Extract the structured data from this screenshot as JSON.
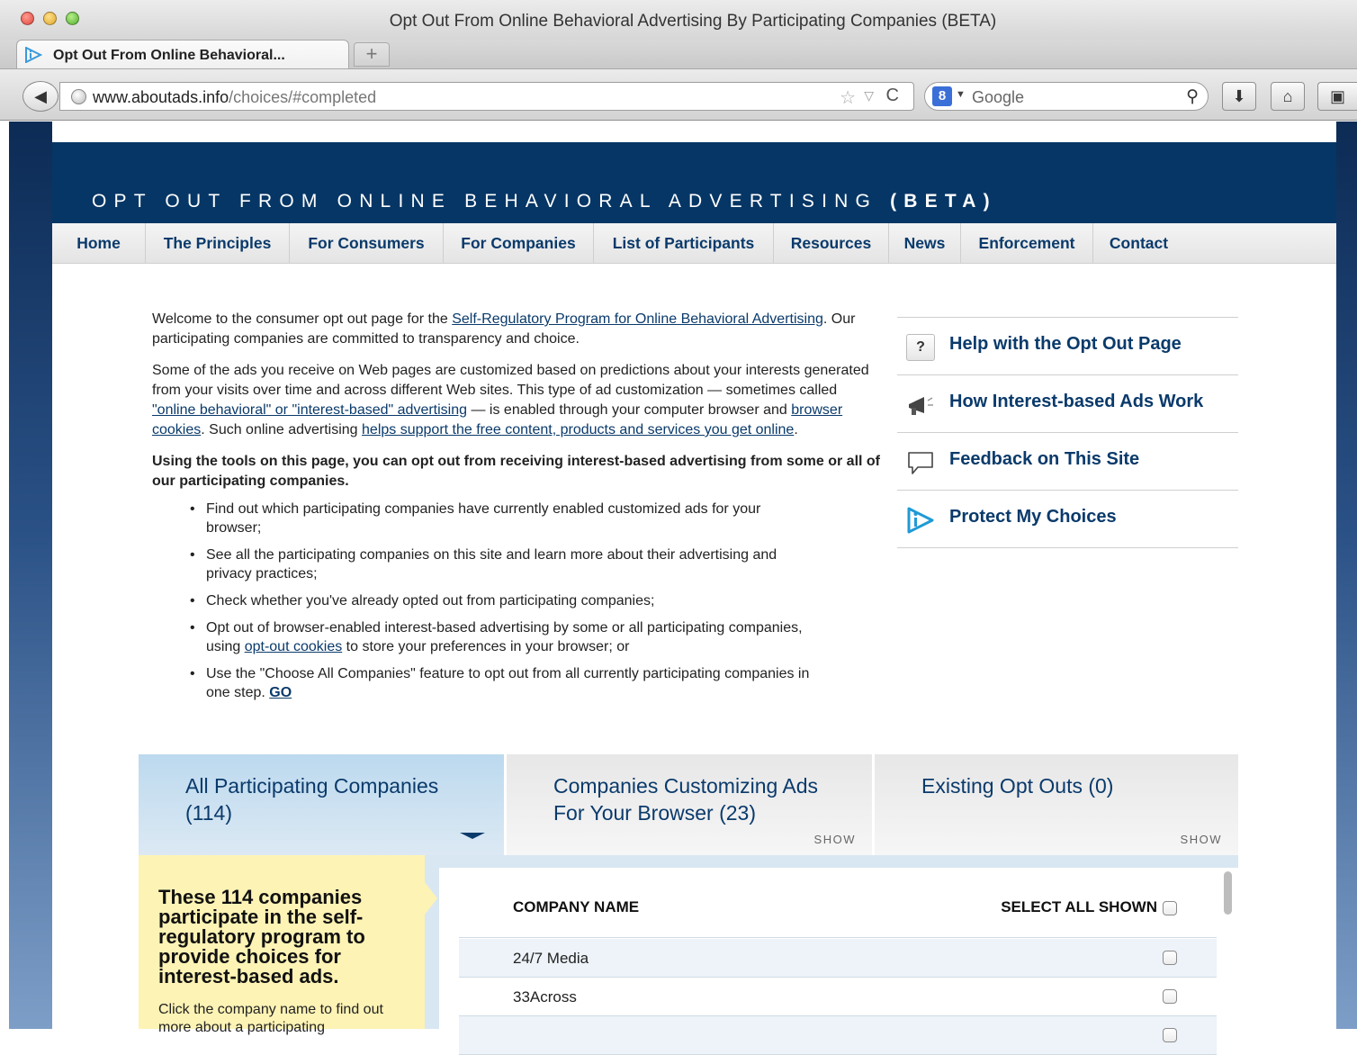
{
  "browser": {
    "window_title": "Opt Out From Online Behavioral Advertising By Participating Companies (BETA)",
    "tab_label": "Opt Out From Online Behavioral...",
    "new_tab_label": "+",
    "url_host": "www.aboutads.info",
    "url_path": "/choices/#completed",
    "search_engine_letter": "8",
    "search_placeholder": "Google",
    "icons": {
      "back": "back-arrow-icon",
      "globe": "globe-icon",
      "star": "bookmark-star-icon",
      "reload": "reload-icon",
      "search": "magnifier-icon",
      "download": "download-icon",
      "home": "home-icon",
      "bookmarks": "bookmarks-icon"
    },
    "glyphs": {
      "back": "◀",
      "star": "☆",
      "dropdown": "▽",
      "reload": "C",
      "caret": "▼",
      "search": "⚲",
      "download": "⬇",
      "home": "⌂",
      "bookmarks": "▣"
    }
  },
  "site": {
    "banner_title_main": "OPT OUT FROM ONLINE BEHAVIORAL ADVERTISING",
    "banner_title_suffix": "(BETA)",
    "nav": [
      "Home",
      "The Principles",
      "For Consumers",
      "For Companies",
      "List of Participants",
      "Resources",
      "News",
      "Enforcement",
      "Contact"
    ],
    "colors": {
      "banner": "#063665",
      "link": "#0a3a6b",
      "info_box": "#fdf3b5",
      "tab_active": "#bcd9ee"
    }
  },
  "intro": {
    "p1_before": "Welcome to the consumer opt out page for the ",
    "p1_link": "Self-Regulatory Program for Online Behavioral Advertising",
    "p1_after": ". Our participating companies are committed to transparency and choice.",
    "p2_a": "Some of the ads you receive on Web pages are customized based on predictions about your interests generated from your visits over time and across different Web sites. This type of ad customization — sometimes called ",
    "p2_link1": "\"online behavioral\" or \"interest-based\" advertising",
    "p2_b": " — is enabled through your computer browser and ",
    "p2_link2": "browser cookies",
    "p2_c": ". Such online advertising ",
    "p2_link3": "helps support the free content, products and services you get online",
    "p2_d": ".",
    "p3": "Using the tools on this page, you can opt out from receiving interest-based advertising from some or all of our participating companies.",
    "bullet1": "Find out which participating companies have currently enabled customized ads for your browser;",
    "bullet2": "See all the participating companies on this site and learn more about their advertising and privacy practices;",
    "bullet3": "Check whether you've already opted out from participating companies;",
    "bullet4_a": "Opt out of browser-enabled interest-based advertising by some or all participating companies, using ",
    "bullet4_link": "opt-out cookies",
    "bullet4_b": " to store your preferences in your browser; or",
    "bullet5_a": "Use the \"Choose All Companies\" feature to opt out from all currently participating companies in one step. ",
    "bullet5_link": "GO"
  },
  "side_links": [
    {
      "label": "Help with the Opt Out Page",
      "icon": "help-icon",
      "glyph": "?"
    },
    {
      "label": "How Interest-based Ads Work",
      "icon": "megaphone-icon"
    },
    {
      "label": "Feedback on This Site",
      "icon": "speech-bubble-icon"
    },
    {
      "label": "Protect My Choices",
      "icon": "adchoices-icon"
    }
  ],
  "tabs": [
    {
      "label": "All Participating Companies (114)",
      "active": true
    },
    {
      "label": "Companies Customizing Ads For Your Browser (23)",
      "show": "SHOW"
    },
    {
      "label": "Existing Opt Outs (0)",
      "show": "SHOW"
    }
  ],
  "info_box": {
    "heading": "These 114 companies participate in the self-regulatory program to provide choices for interest-based ads.",
    "text": "Click the company name to find out more about a participating"
  },
  "company_list": {
    "col_name": "COMPANY NAME",
    "col_select": "SELECT ALL SHOWN",
    "rows": [
      {
        "name": "24/7 Media"
      },
      {
        "name": "33Across"
      },
      {
        "name": ""
      }
    ]
  }
}
